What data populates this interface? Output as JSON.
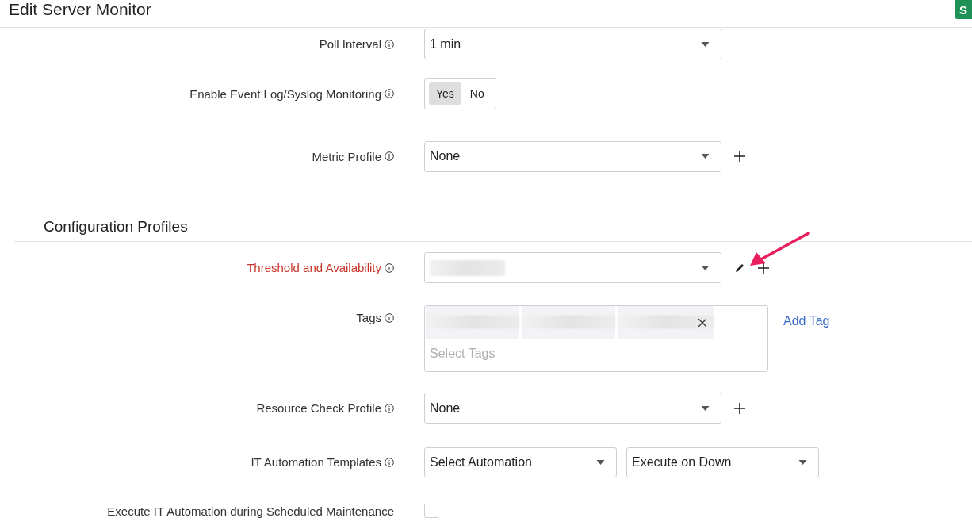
{
  "header": {
    "title": "Edit Server Monitor",
    "action_button": "S"
  },
  "form_rows": [
    {
      "kind": "select",
      "label": "Poll Interval",
      "info": true,
      "value": "1 min",
      "add": false,
      "edit": false,
      "highlighted": false
    },
    {
      "kind": "toggle",
      "label": "Enable Event Log/Syslog Monitoring",
      "info": true,
      "highlighted": false,
      "options": [
        {
          "label": "Yes",
          "selected": true
        },
        {
          "label": "No",
          "selected": false
        }
      ]
    },
    {
      "kind": "select",
      "label": "Metric Profile",
      "info": true,
      "value": "None",
      "add": true,
      "edit": false,
      "highlighted": false
    },
    {
      "kind": "section",
      "title": "Configuration Profiles"
    },
    {
      "kind": "select",
      "label": "Threshold and Availability",
      "info": true,
      "value_hidden": true,
      "add": true,
      "edit": true,
      "highlighted": true
    },
    {
      "kind": "tags",
      "label": "Tags",
      "info": true,
      "highlighted": false,
      "placeholder": "Select Tags",
      "link": "Add Tag",
      "tags": [
        {
          "kind": "redacted",
          "removable": false
        },
        {
          "kind": "redacted",
          "removable": false
        },
        {
          "kind": "redacted",
          "removable": true
        }
      ]
    },
    {
      "kind": "select",
      "label": "Resource Check Profile",
      "info": true,
      "value": "None",
      "add": true,
      "edit": false,
      "highlighted": false
    },
    {
      "kind": "select_pair",
      "label": "IT Automation Templates",
      "info": true,
      "highlighted": false,
      "values": [
        "Select Automation",
        "Execute on Down"
      ]
    },
    {
      "kind": "checkbox",
      "label": "Execute IT Automation during Scheduled Maintenance",
      "info": false,
      "highlighted": false,
      "checked": false
    }
  ],
  "annotations": [
    {
      "kind": "arrow"
    }
  ]
}
